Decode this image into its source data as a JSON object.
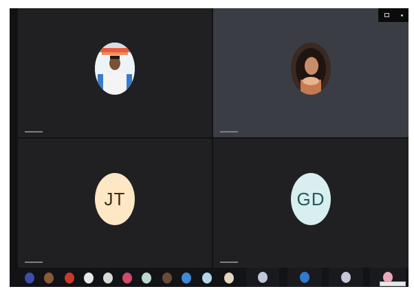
{
  "tiles": [
    {
      "name": "",
      "avatar": "photo-man-icon"
    },
    {
      "name": "",
      "avatar": "photo-woman-icon"
    },
    {
      "name": "",
      "initials": "JT",
      "avatar_color": "#fde7c4"
    },
    {
      "name": "",
      "initials": "GD",
      "avatar_color": "#d9eeee"
    }
  ],
  "filmstrip": {
    "thumbnail_colors": [
      "#3b4fa8",
      "#8a5a3a",
      "#c83a2a",
      "#e9e9e9",
      "#d8d8d8",
      "#d14a6a",
      "#b9d8d0",
      "#6a4a3a",
      "#3f8ad8",
      "#b4d6e8",
      "#e6d5c0",
      "#c0c8d8",
      "#2f7ad0",
      "#c8c6dc",
      "#e7a9b9"
    ]
  },
  "colors": {
    "screen_bg": "#111214",
    "tile_dark": "#202023",
    "tile_highlight": "#3b3d45"
  }
}
